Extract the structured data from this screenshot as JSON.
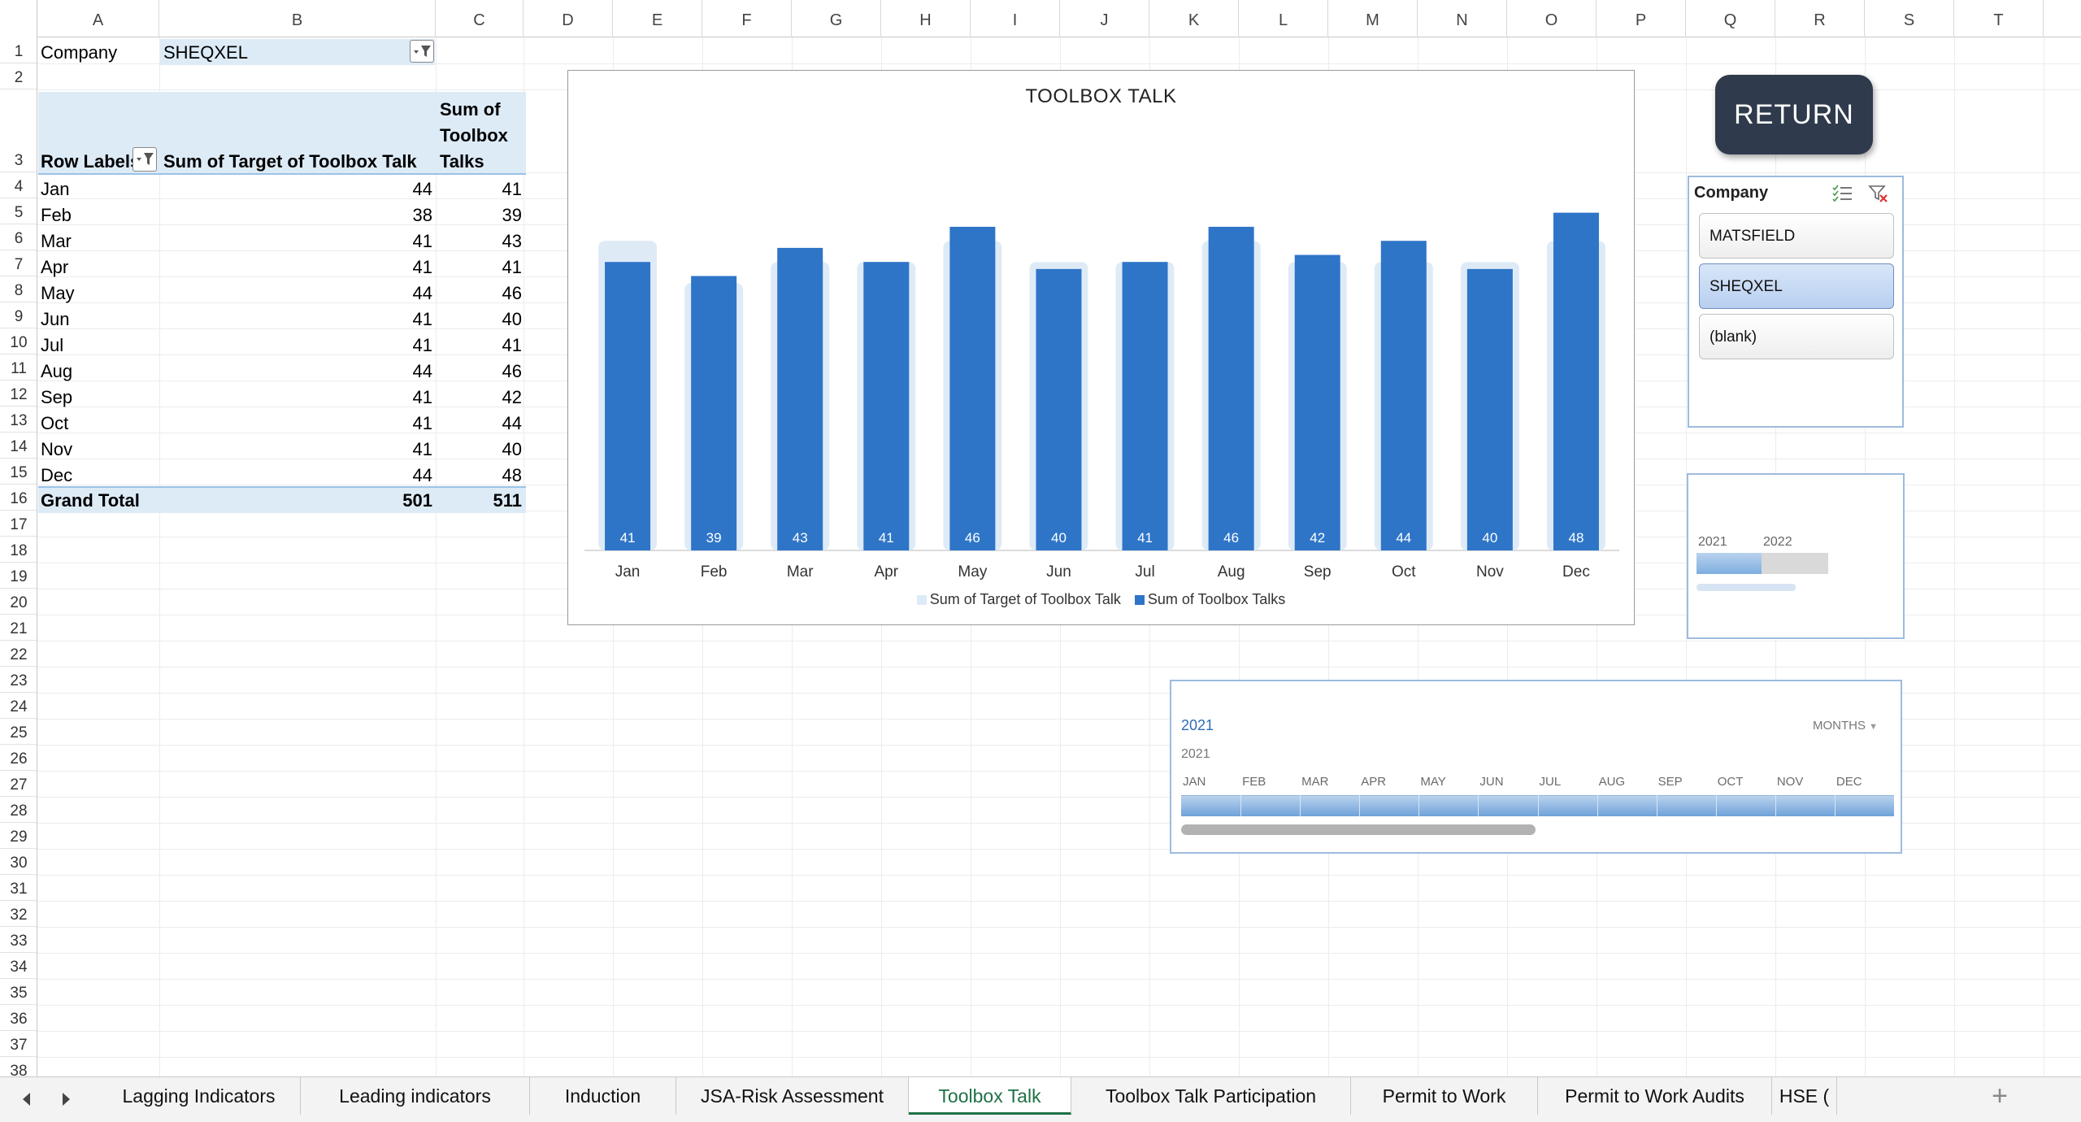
{
  "columns": [
    "A",
    "B",
    "C",
    "D",
    "E",
    "F",
    "G",
    "H",
    "I",
    "J",
    "K",
    "L",
    "M",
    "N",
    "O",
    "P",
    "Q",
    "R",
    "S",
    "T"
  ],
  "rows": [
    "1",
    "2",
    "3",
    "4",
    "5",
    "6",
    "7",
    "8",
    "9",
    "10",
    "11",
    "12",
    "13",
    "14",
    "15",
    "16",
    "17",
    "18",
    "19",
    "20",
    "21",
    "22",
    "23",
    "24",
    "25",
    "26",
    "27",
    "28",
    "29",
    "30",
    "31",
    "32",
    "33",
    "34",
    "35",
    "36",
    "37",
    "38"
  ],
  "filter": {
    "label": "Company",
    "value": "SHEQXEL"
  },
  "pivot": {
    "header_row_labels": "Row Labels",
    "header_target": "Sum of Target of Toolbox Talk",
    "header_talks_lines": [
      "Sum of",
      "Toolbox",
      "Talks"
    ],
    "rows": [
      {
        "month": "Jan",
        "target": "44",
        "talks": "41"
      },
      {
        "month": "Feb",
        "target": "38",
        "talks": "39"
      },
      {
        "month": "Mar",
        "target": "41",
        "talks": "43"
      },
      {
        "month": "Apr",
        "target": "41",
        "talks": "41"
      },
      {
        "month": "May",
        "target": "44",
        "talks": "46"
      },
      {
        "month": "Jun",
        "target": "41",
        "talks": "40"
      },
      {
        "month": "Jul",
        "target": "41",
        "talks": "41"
      },
      {
        "month": "Aug",
        "target": "44",
        "talks": "46"
      },
      {
        "month": "Sep",
        "target": "41",
        "talks": "42"
      },
      {
        "month": "Oct",
        "target": "41",
        "talks": "44"
      },
      {
        "month": "Nov",
        "target": "41",
        "talks": "40"
      },
      {
        "month": "Dec",
        "target": "44",
        "talks": "48"
      }
    ],
    "grand_total": {
      "label": "Grand Total",
      "target": "501",
      "talks": "511"
    }
  },
  "chart_data": {
    "type": "bar",
    "title": "TOOLBOX TALK",
    "categories": [
      "Jan",
      "Feb",
      "Mar",
      "Apr",
      "May",
      "Jun",
      "Jul",
      "Aug",
      "Sep",
      "Oct",
      "Nov",
      "Dec"
    ],
    "series": [
      {
        "name": "Sum of Target of Toolbox Talk",
        "values": [
          44,
          38,
          41,
          41,
          44,
          41,
          41,
          44,
          41,
          41,
          41,
          44
        ],
        "color": "#deebf7"
      },
      {
        "name": "Sum of Toolbox Talks",
        "values": [
          41,
          39,
          43,
          41,
          46,
          40,
          41,
          46,
          42,
          44,
          40,
          48
        ],
        "color": "#2e75c8"
      }
    ],
    "data_labels": [
      "41",
      "39",
      "43",
      "41",
      "46",
      "40",
      "41",
      "46",
      "42",
      "44",
      "40",
      "48"
    ],
    "ylim": [
      0,
      52
    ],
    "grid": false,
    "legend": "bottom"
  },
  "return_button": {
    "label": "RETURN"
  },
  "slicer": {
    "title": "Company",
    "items": [
      {
        "label": "MATSFIELD",
        "selected": false
      },
      {
        "label": "SHEQXEL",
        "selected": true
      },
      {
        "label": "(blank)",
        "selected": false
      }
    ]
  },
  "yearbox": {
    "years": [
      "2021",
      "2022"
    ]
  },
  "timeline": {
    "header": "2021",
    "level": "MONTHS",
    "year": "2021",
    "months": [
      "JAN",
      "FEB",
      "MAR",
      "APR",
      "MAY",
      "JUN",
      "JUL",
      "AUG",
      "SEP",
      "OCT",
      "NOV",
      "DEC"
    ]
  },
  "sheet_tabs": [
    {
      "label": "Lagging Indicators",
      "active": false
    },
    {
      "label": "Leading indicators",
      "active": false
    },
    {
      "label": "Induction",
      "active": false
    },
    {
      "label": "JSA-Risk Assessment",
      "active": false
    },
    {
      "label": "Toolbox Talk",
      "active": true
    },
    {
      "label": "Toolbox Talk Participation",
      "active": false
    },
    {
      "label": "Permit to Work",
      "active": false
    },
    {
      "label": "Permit to Work Audits",
      "active": false
    },
    {
      "label": "HSE (",
      "active": false
    }
  ],
  "colors": {
    "accent": "#1e7145",
    "bar": "#2e75c8",
    "target": "#deebf7",
    "pivot": "#ddebf7"
  }
}
